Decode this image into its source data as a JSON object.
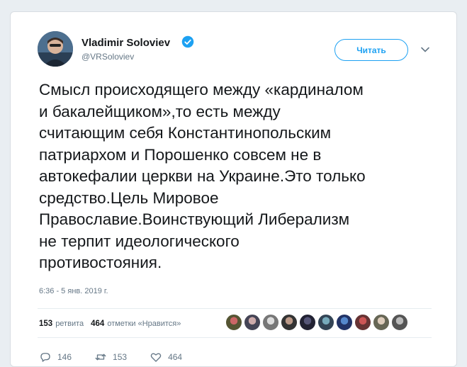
{
  "author": {
    "name": "Vladimir Soloviev",
    "handle": "@VRSoloviev"
  },
  "follow_label": "Читать",
  "tweet_lines": [
    "Смысл происходящего между «кардиналом",
    "и бакалейщиком»,то есть между",
    "считающим себя Константинопольским",
    "патриархом и Порошенко совсем не в",
    "автокефалии церкви на Украине.Это только",
    "средство.Цель Мировое",
    "Православие.Воинствующий Либерализм",
    "не терпит идеологического",
    "противостояния."
  ],
  "timestamp": "6:36 - 5 янв. 2019 г.",
  "stats": {
    "retweets_count": "153",
    "retweets_label": "ретвита",
    "likes_count": "464",
    "likes_label": "отметки «Нравится»"
  },
  "actions": {
    "replies": "146",
    "retweets": "153",
    "likes": "464"
  },
  "colors": {
    "accent": "#1da1f2",
    "text": "#14171a",
    "muted": "#657786"
  },
  "icons": [
    "verified-badge-icon",
    "chevron-down-icon",
    "reply-icon",
    "retweet-icon",
    "heart-icon"
  ]
}
